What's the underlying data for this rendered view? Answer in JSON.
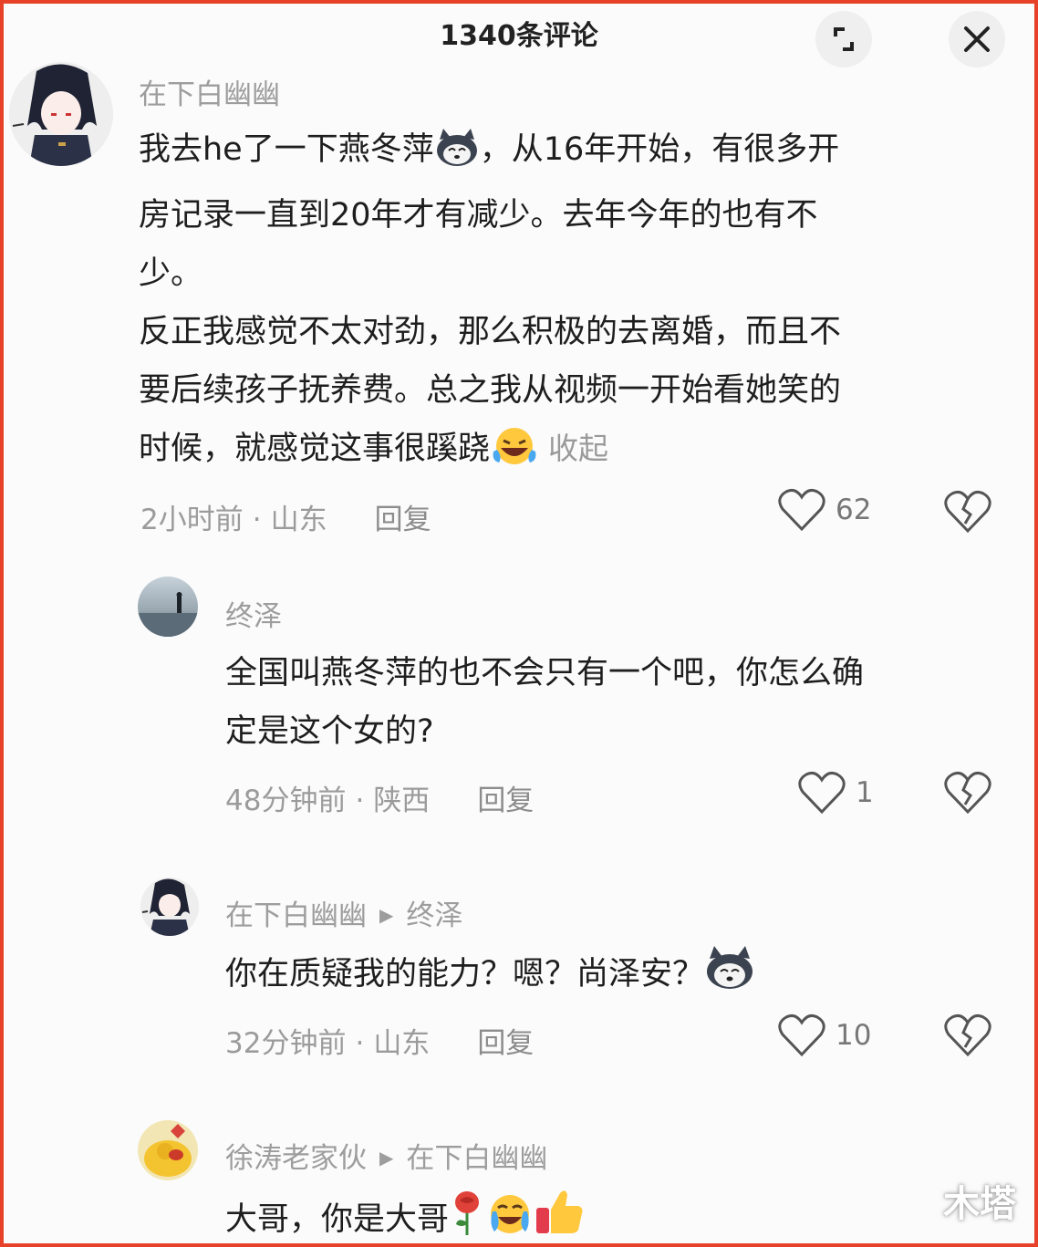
{
  "header": {
    "title": "1340条评论"
  },
  "comments": [
    {
      "user": "在下白幽幽",
      "text_lines": [
        "我去he了一下燕冬萍",
        "，从16年开始，有很多开",
        "房记录一直到20年才有减少。去年今年的也有不",
        "少。",
        "反正我感觉不太对劲，那么积极的去离婚，而且不",
        "要后续孩子抚养费。总之我从视频一开始看她笑的",
        "时候，就感觉这事很蹊跷"
      ],
      "collapse_label": "收起",
      "time": "2小时前",
      "location": "山东",
      "reply_label": "回复",
      "likes": "62"
    },
    {
      "user": "终泽",
      "text_lines": [
        "全国叫燕冬萍的也不会只有一个吧，你怎么确",
        "定是这个女的?"
      ],
      "time": "48分钟前",
      "location": "陕西",
      "reply_label": "回复",
      "likes": "1"
    },
    {
      "user": "在下白幽幽",
      "reply_to": "终泽",
      "text_lines": [
        "你在质疑我的能力？嗯？尚泽安？"
      ],
      "time": "32分钟前",
      "location": "山东",
      "reply_label": "回复",
      "likes": "10"
    },
    {
      "user": "徐涛老家伙",
      "reply_to": "在下白幽幽",
      "text_lines": [
        "大哥，你是大哥"
      ]
    }
  ],
  "icons": {
    "expand": "expand-icon",
    "close": "close-icon",
    "like": "heart-icon",
    "dislike": "broken-heart-icon"
  },
  "watermark": "木塔"
}
